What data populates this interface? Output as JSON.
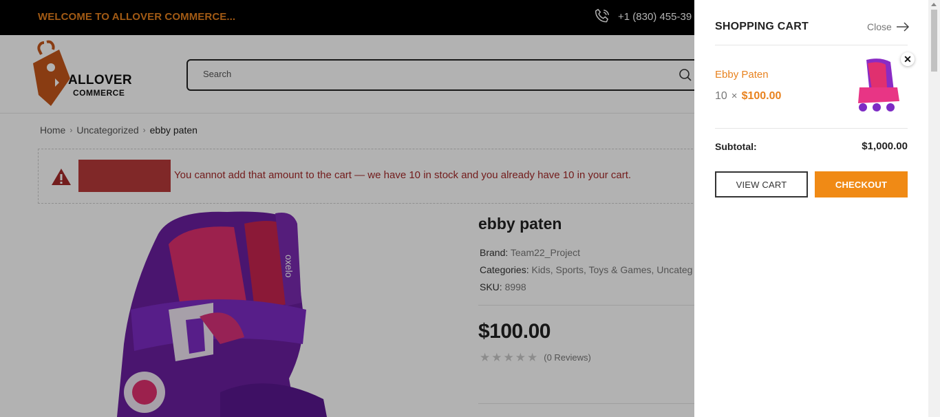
{
  "topbar": {
    "welcome": "WELCOME TO ALLOVER COMMERCE...",
    "phone": "+1 (830) 455-39"
  },
  "logo": {
    "line1": "ALLOVER",
    "line2": "COMMERCE"
  },
  "search": {
    "placeholder": "Search"
  },
  "breadcrumb": {
    "items": [
      "Home",
      "Uncategorized",
      "ebby paten"
    ]
  },
  "notice": {
    "message": "You cannot add that amount to the cart — we have 10 in stock and you already have 10 in your cart."
  },
  "product": {
    "title": "ebby paten",
    "brand_label": "Brand:",
    "brand": "Team22_Project",
    "categories_label": "Categories:",
    "categories": "Kids, Sports, Toys & Games, Uncateg",
    "sku_label": "SKU:",
    "sku": "8998",
    "price": "$100.00",
    "rating": 0,
    "reviews": "(0 Reviews)",
    "image_text": "oxelo"
  },
  "cart": {
    "title": "SHOPPING CART",
    "close_label": "Close",
    "item": {
      "name": "Ebby Paten",
      "qty": "10",
      "times": "×",
      "price": "$100.00"
    },
    "subtotal_label": "Subtotal:",
    "subtotal": "$1,000.00",
    "view_cart_label": "VIEW CART",
    "checkout_label": "CHECKOUT"
  },
  "colors": {
    "accent": "#e8821e",
    "checkout": "#f08a15",
    "error": "#a52a2a",
    "topbar": "#000000"
  },
  "icons": [
    "phone-icon",
    "search-icon",
    "warning-icon",
    "arrow-right-icon",
    "close-icon",
    "star-icon"
  ]
}
